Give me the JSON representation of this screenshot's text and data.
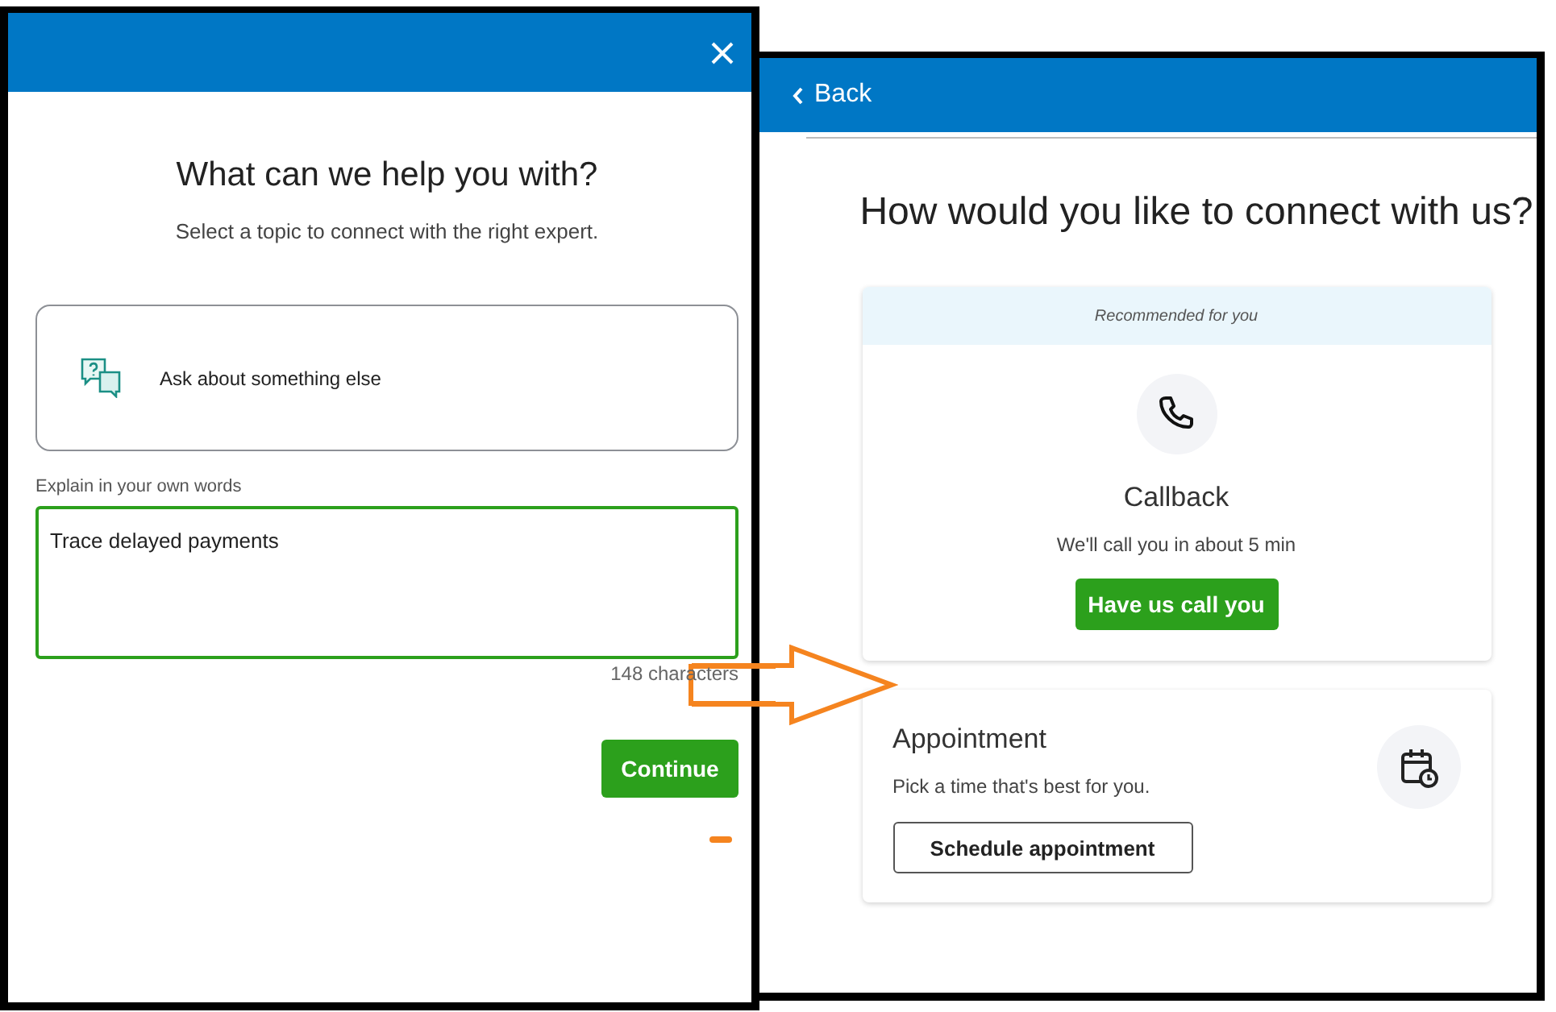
{
  "help_dialog": {
    "heading": "What can we help you with?",
    "subheading": "Select a topic to connect with the right expert.",
    "topic": {
      "label": "Ask about something else"
    },
    "description": {
      "label": "Explain in your own words",
      "value": "Trace delayed payments",
      "counter": "148 characters"
    },
    "continue_button": "Continue"
  },
  "connect_dialog": {
    "back_button": "Back",
    "heading": "How would you like to connect with us?",
    "options": [
      {
        "kind": "callback",
        "banner": "Recommended for you",
        "title": "Callback",
        "description": "We'll call you in about 5 min",
        "button": "Have us call you"
      },
      {
        "kind": "appointment",
        "title": "Appointment",
        "description": "Pick a time that's best for you.",
        "button": "Schedule appointment"
      }
    ]
  }
}
